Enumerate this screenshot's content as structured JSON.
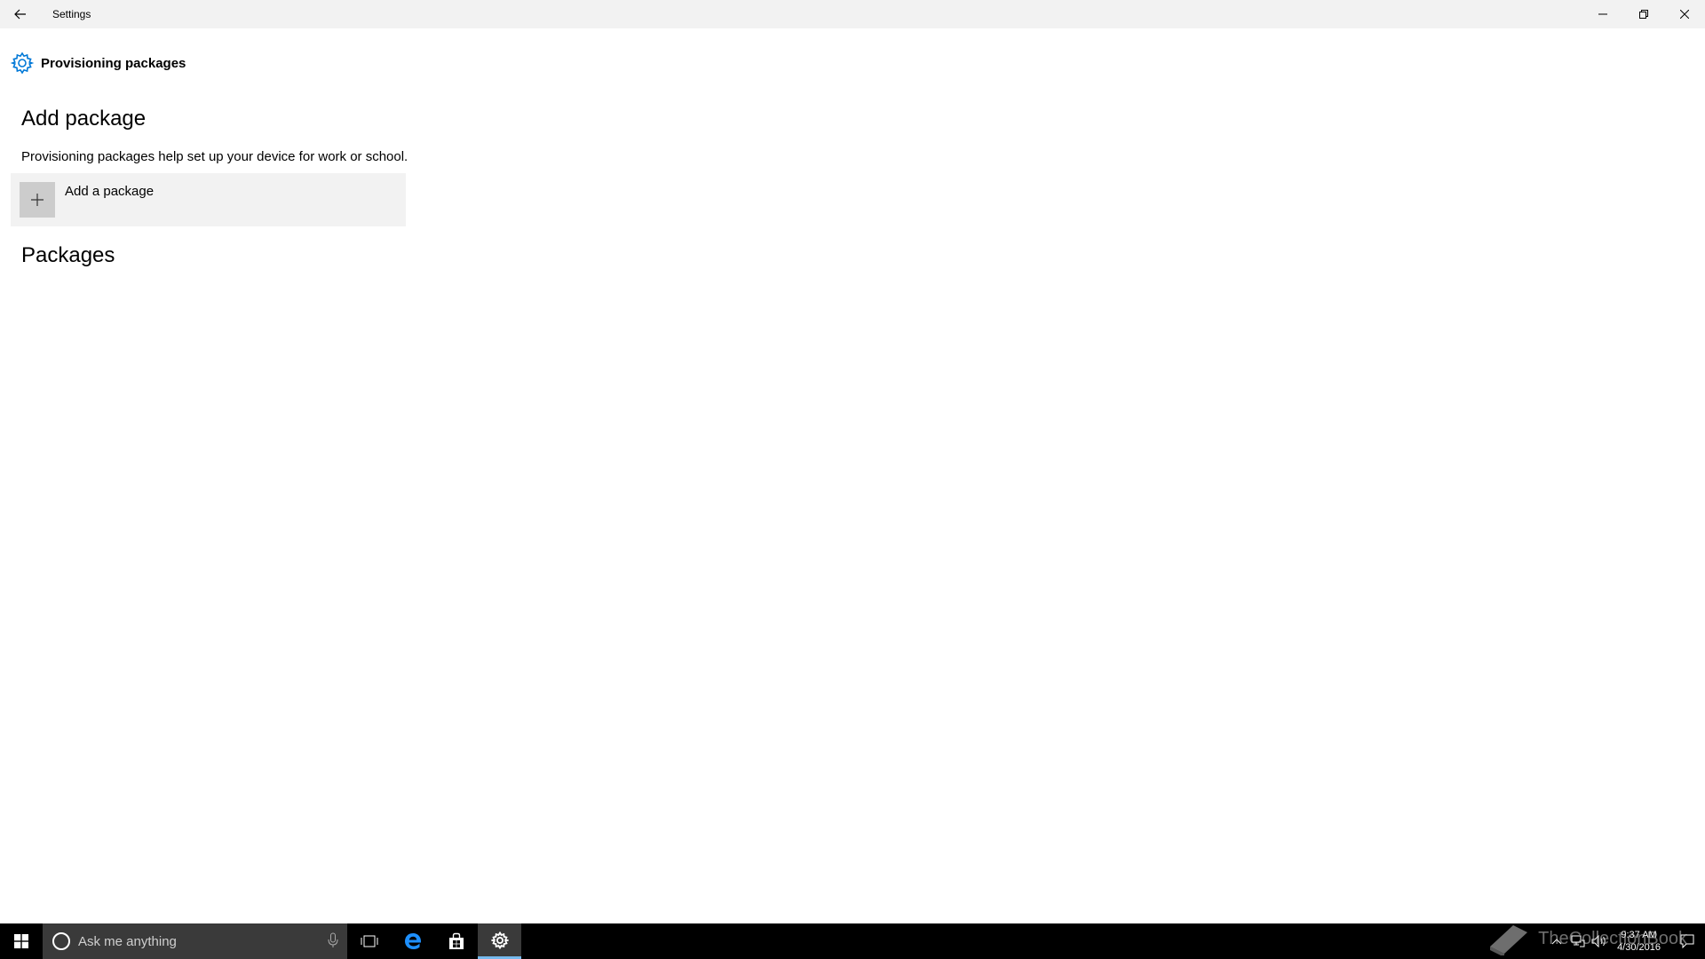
{
  "window": {
    "title": "Settings",
    "back_icon": "back-arrow-icon",
    "controls": [
      "minimize-icon",
      "restore-icon",
      "close-icon"
    ]
  },
  "page": {
    "icon": "gear-icon",
    "title": "Provisioning packages",
    "add_section_title": "Add package",
    "description": "Provisioning packages help set up your device for work or school.",
    "add_button_label": "Add a package",
    "packages_section_title": "Packages"
  },
  "taskbar": {
    "search_placeholder": "Ask me anything",
    "apps": [
      "task-view-icon",
      "edge-icon",
      "store-icon",
      "settings-icon"
    ],
    "active_app": "settings-icon",
    "clock_time": "9:37 AM",
    "clock_date": "4/30/2016"
  },
  "watermark": {
    "text": "TheCollectionBook"
  },
  "colors": {
    "accent": "#0078d7",
    "titlebar_bg": "#f2f2f2",
    "taskbar_bg": "#000000",
    "active_underline": "#76b9ed"
  }
}
